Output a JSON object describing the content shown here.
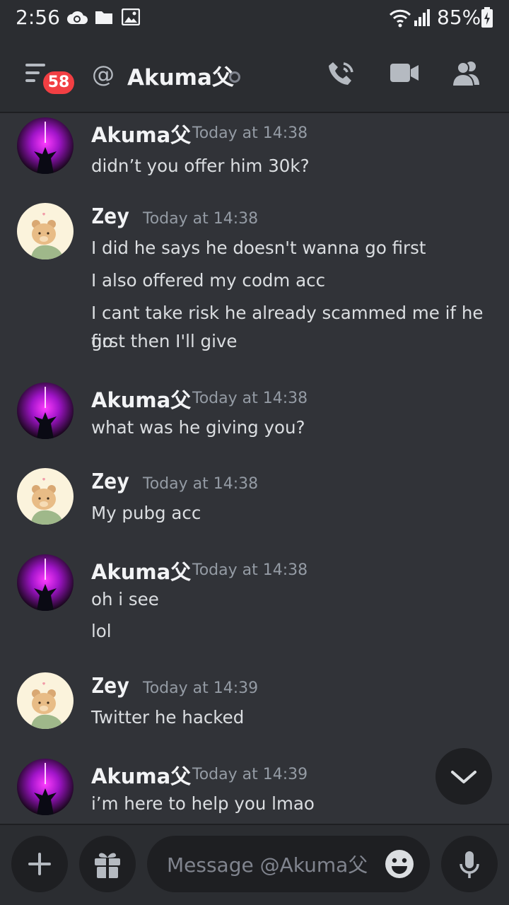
{
  "status_bar": {
    "time": "2:56",
    "battery": "85%",
    "icons": [
      "cloud-sync-icon",
      "folder-icon",
      "image-icon",
      "wifi-icon",
      "signal-icon",
      "battery-charging-icon"
    ]
  },
  "header": {
    "badge_count": "58",
    "at_symbol": "@",
    "channel_name": "Akuma父",
    "icons": [
      "hamburger-menu-icon",
      "call-icon",
      "video-icon",
      "members-icon"
    ]
  },
  "messages": [
    {
      "author": "Akuma父",
      "timestamp": "Today at 14:38",
      "avatar": "akuma-avatar",
      "lines": [
        "didn’t you offer him 30k?"
      ]
    },
    {
      "author": "Zey",
      "timestamp": "Today at 14:38",
      "avatar": "zey-avatar",
      "lines": [
        "I did he says he doesn't wanna go first",
        "I also offered my codm acc",
        "I cant take risk he already scammed me if he go",
        "first then I'll give"
      ]
    },
    {
      "author": "Akuma父",
      "timestamp": "Today at 14:38",
      "avatar": "akuma-avatar",
      "lines": [
        "what was he giving you?"
      ]
    },
    {
      "author": "Zey",
      "timestamp": "Today at 14:38",
      "avatar": "zey-avatar",
      "lines": [
        "My pubg acc"
      ]
    },
    {
      "author": "Akuma父",
      "timestamp": "Today at 14:38",
      "avatar": "akuma-avatar",
      "lines": [
        "oh i see",
        "lol"
      ]
    },
    {
      "author": "Zey",
      "timestamp": "Today at 14:39",
      "avatar": "zey-avatar",
      "lines": [
        "Twitter he hacked"
      ]
    },
    {
      "author": "Akuma父",
      "timestamp": "Today at 14:39",
      "avatar": "akuma-avatar",
      "lines": [
        "i’m here to help you lmao"
      ]
    }
  ],
  "composer": {
    "placeholder": "Message @Akuma父",
    "icons": [
      "plus-icon",
      "gift-icon",
      "emoji-icon",
      "microphone-icon"
    ]
  },
  "colors": {
    "background": "#313338",
    "header_bg": "#2b2d31",
    "input_bg": "#1e1f22",
    "badge": "#f23f43",
    "text": "#dbdee1",
    "muted": "#949ba4"
  }
}
